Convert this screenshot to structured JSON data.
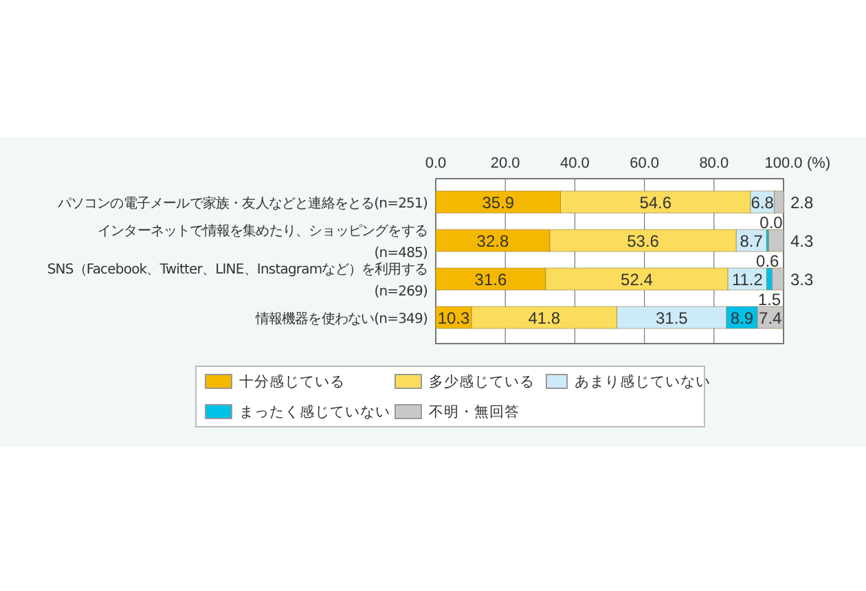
{
  "figure": {
    "chart_data": {
      "type": "bar",
      "orientation": "horizontal",
      "stacked": true,
      "value_labels": [
        [
          "35.9",
          "32.8",
          "31.6",
          "10.3"
        ],
        [
          "54.6",
          "53.6",
          "52.4",
          "41.8"
        ],
        [
          "6.8",
          "8.7",
          "11.2",
          "31.5"
        ],
        [
          "0.0",
          "0.6",
          "1.5",
          "8.9"
        ],
        [
          "2.8",
          "4.3",
          "3.3",
          "7.4"
        ]
      ],
      "xlabel": "(%)",
      "categories": [
        "パソコンの電子メールで家族・友人などと連絡をとる(n=251)",
        "インターネットで情報を集めたり、ショッピングをする\n(n=485)",
        "SNS（Facebook、Twitter、LINE、Instagramなど）を利用する\n(n=269)",
        "情報機器を使わない(n=349)"
      ],
      "xlim": [
        0,
        100
      ],
      "grid": true,
      "legend": true,
      "xticks": [
        {
          "value": 0,
          "label": "0.0"
        },
        {
          "value": 20,
          "label": "20.0"
        },
        {
          "value": 40,
          "label": "40.0"
        },
        {
          "value": 60,
          "label": "60.0"
        },
        {
          "value": 80,
          "label": "80.0"
        },
        {
          "value": 100,
          "label": "100.0"
        }
      ],
      "series": [
        {
          "name": "十分感じている",
          "color": "#f5b800",
          "values": [
            35.9,
            32.8,
            31.6,
            10.3
          ]
        },
        {
          "name": "多少感じている",
          "color": "#fbdc5c",
          "values": [
            54.6,
            53.6,
            52.4,
            41.8
          ]
        },
        {
          "name": "あまり感じていない",
          "color": "#cdeaf8",
          "values": [
            6.8,
            8.7,
            11.2,
            31.5
          ]
        },
        {
          "name": "まったく感じていない",
          "color": "#00c0e8",
          "values": [
            0.0,
            0.6,
            1.5,
            8.9
          ]
        },
        {
          "name": "不明・無回答",
          "color": "#c8c8c8",
          "values": [
            2.8,
            4.3,
            3.3,
            7.4
          ]
        }
      ]
    }
  }
}
